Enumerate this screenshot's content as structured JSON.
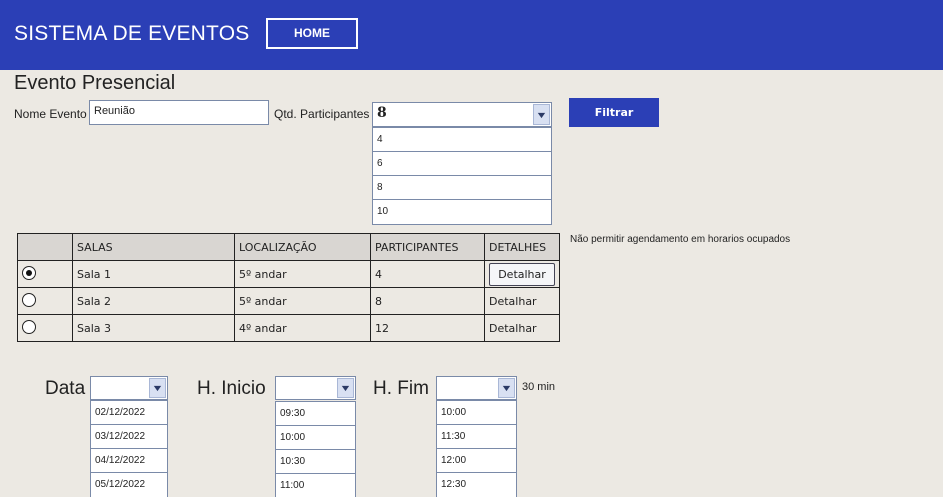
{
  "header": {
    "title": "SISTEMA DE EVENTOS",
    "home": "HOME"
  },
  "page_title": "Evento Presencial",
  "filters": {
    "name_label": "Nome Evento",
    "name_value": "Reunião",
    "qty_label": "Qtd. Participantes",
    "qty_selected": "8",
    "qty_options": [
      "4",
      "6",
      "8",
      "10"
    ],
    "filter_button": "Filtrar"
  },
  "note": "Não permitir agendamento em horarios ocupados",
  "table": {
    "headers": [
      "",
      "SALAS",
      "LOCALIZAÇÃO",
      "PARTICIPANTES",
      "DETALHES"
    ],
    "rows": [
      {
        "selected": true,
        "room": "Sala 1",
        "location": "5º andar",
        "participants": "4",
        "details": "Detalhar"
      },
      {
        "selected": false,
        "room": "Sala 2",
        "location": "5º andar",
        "participants": "8",
        "details": "Detalhar"
      },
      {
        "selected": false,
        "room": "Sala 3",
        "location": "4º andar",
        "participants": "12",
        "details": "Detalhar"
      }
    ]
  },
  "schedule": {
    "date_label": "Data",
    "date_options": [
      "02/12/2022",
      "03/12/2022",
      "04/12/2022",
      "05/12/2022"
    ],
    "start_label": "H. Inicio",
    "start_options": [
      "09:30",
      "10:00",
      "10:30",
      "11:00"
    ],
    "end_label": "H. Fim",
    "end_options": [
      "10:00",
      "11:30",
      "12:00",
      "12:30"
    ],
    "duration": "30 min"
  }
}
